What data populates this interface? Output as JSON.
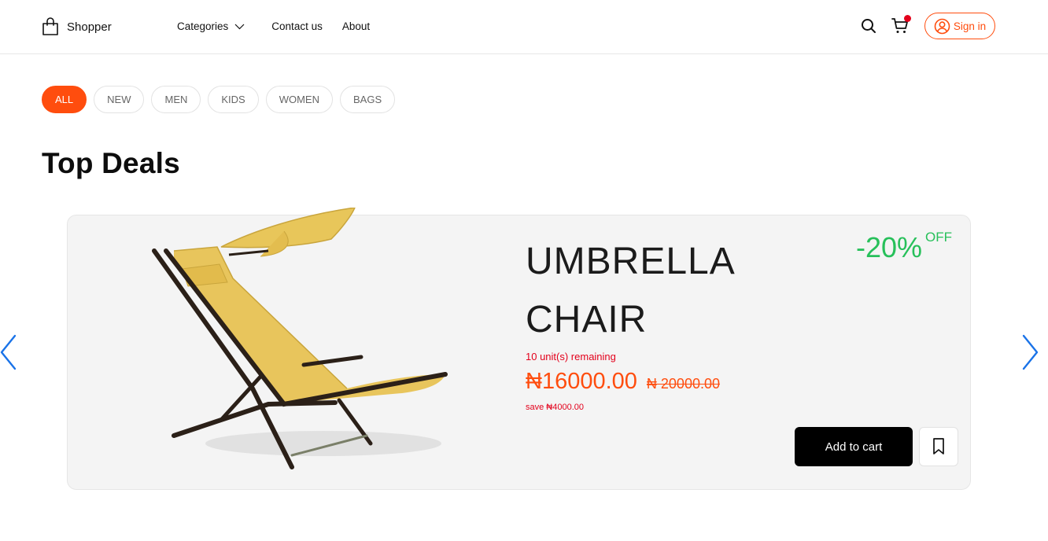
{
  "header": {
    "logo_text": "Shopper",
    "logo_icon": "shopping-bag-icon",
    "nav": {
      "categories_label": "Categories",
      "contact_label": "Contact us",
      "about_label": "About"
    },
    "signin_label": "Sign in",
    "icons": [
      "search-icon",
      "cart-icon",
      "user-circle-icon"
    ]
  },
  "filters": {
    "all": "ALL",
    "new": "NEW",
    "men": "MEN",
    "kids": "KIDS",
    "women": "WOMEN",
    "bags": "BAGS",
    "active": "ALL"
  },
  "section": {
    "title": "Top Deals"
  },
  "deal": {
    "name_line1": "UMBRELLA",
    "name_line2": "CHAIR",
    "discount_value": "-20%",
    "discount_suffix": "OFF",
    "remaining": "10 unit(s) remaining",
    "price_current": "₦16000.00",
    "price_old": "₦ 20000.00",
    "savings": "save ₦4000.00",
    "add_to_cart_label": "Add to cart"
  },
  "colors": {
    "accent": "#ff4d0e",
    "discount": "#27c05a",
    "alert": "#e3001b",
    "arrow": "#1a73e8"
  }
}
